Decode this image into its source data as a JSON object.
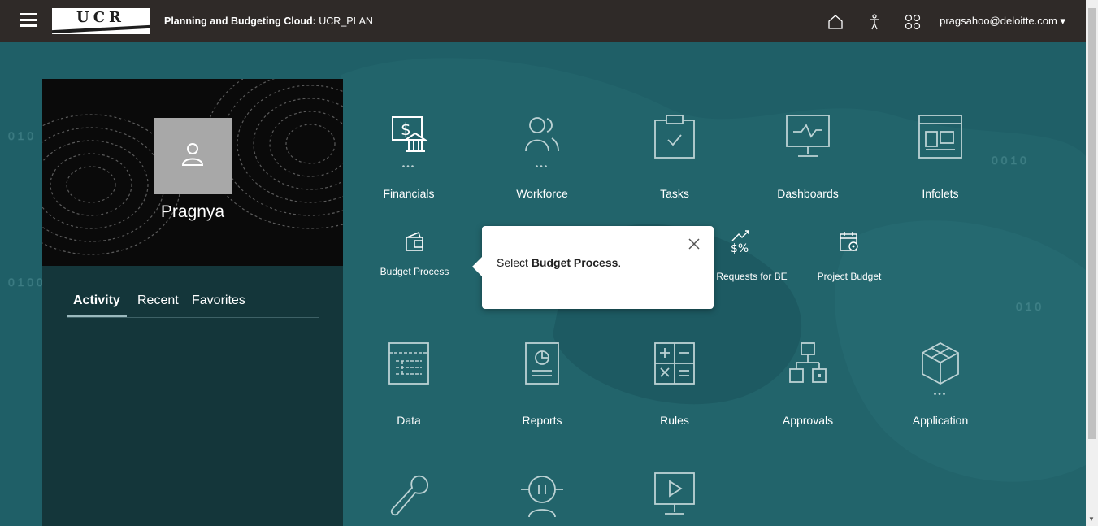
{
  "header": {
    "logo_text": "UCR",
    "title_bold": "Planning and Budgeting Cloud:",
    "title_rest": " UCR_PLAN",
    "user_email": "pragsahoo@deloitte.com",
    "user_caret": "▾",
    "icons": [
      "home-icon",
      "accessibility-icon",
      "navigator-icon"
    ]
  },
  "profile": {
    "name": "Pragnya",
    "tabs": [
      "Activity",
      "Recent",
      "Favorites"
    ],
    "active_tab": "Activity"
  },
  "cards_row1": [
    {
      "label": "Financials",
      "icon": "financials-icon",
      "dots": "•••"
    },
    {
      "label": "Workforce",
      "icon": "workforce-icon",
      "dots": "•••"
    },
    {
      "label": "Tasks",
      "icon": "tasks-icon"
    },
    {
      "label": "Dashboards",
      "icon": "dashboards-icon"
    },
    {
      "label": "Infolets",
      "icon": "infolets-icon"
    }
  ],
  "sub_row": [
    {
      "label": "Budget Process",
      "icon": "budget-process-icon"
    },
    {
      "label": "get Requests for BE",
      "icon": "budget-requests-icon"
    },
    {
      "label": "Project Budget",
      "icon": "project-budget-icon"
    }
  ],
  "cards_row2": [
    {
      "label": "Data",
      "icon": "data-icon"
    },
    {
      "label": "Reports",
      "icon": "reports-icon"
    },
    {
      "label": "Rules",
      "icon": "rules-icon"
    },
    {
      "label": "Approvals",
      "icon": "approvals-icon"
    },
    {
      "label": "Application",
      "icon": "application-icon",
      "dots": "•••"
    }
  ],
  "cards_row3": [
    {
      "icon": "tools-icon"
    },
    {
      "icon": "academy-icon"
    },
    {
      "icon": "video-icon"
    }
  ],
  "popup": {
    "prefix": "Select ",
    "bold": "Budget Process",
    "suffix": "."
  },
  "colors": {
    "topbar": "#2f2a28",
    "background": "#1f5f67",
    "left_panel": "#14363a"
  }
}
